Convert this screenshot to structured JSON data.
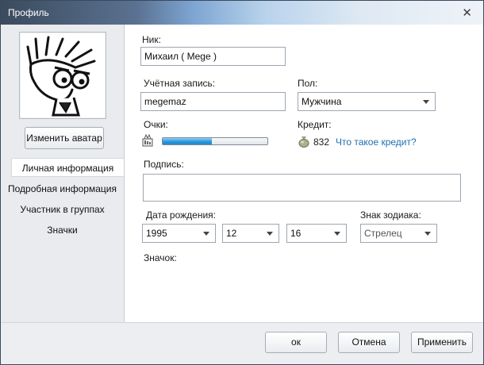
{
  "window": {
    "title": "Профиль",
    "close_glyph": "✕"
  },
  "sidebar": {
    "change_avatar_label": "Изменить аватар",
    "items": [
      {
        "label": "Личная информация",
        "active": true
      },
      {
        "label": "Подробная информация",
        "active": false
      },
      {
        "label": "Участник в группах",
        "active": false
      },
      {
        "label": "Значки",
        "active": false
      }
    ]
  },
  "form": {
    "nick": {
      "label": "Ник:",
      "value": "Михаил ( Mege )"
    },
    "account": {
      "label": "Учётная запись:",
      "value": "megemaz"
    },
    "gender": {
      "label": "Пол:",
      "value": "Мужчина"
    },
    "points": {
      "label": "Очки:",
      "progress": 0.47,
      "icon": "level-icon"
    },
    "credit": {
      "label": "Кредит:",
      "value": "832",
      "link": "Что такое кредит?",
      "icon": "money-bag-icon"
    },
    "signature": {
      "label": "Подпись:",
      "value": ""
    },
    "birthdate": {
      "label": "Дата рождения:",
      "year": "1995",
      "month": "12",
      "day": "16"
    },
    "zodiac": {
      "label": "Знак зодиака:",
      "value": "Стрелец"
    },
    "badge": {
      "label": "Значок:"
    }
  },
  "footer": {
    "ok_label": "ок",
    "cancel_label": "Отмена",
    "apply_label": "Применить"
  }
}
